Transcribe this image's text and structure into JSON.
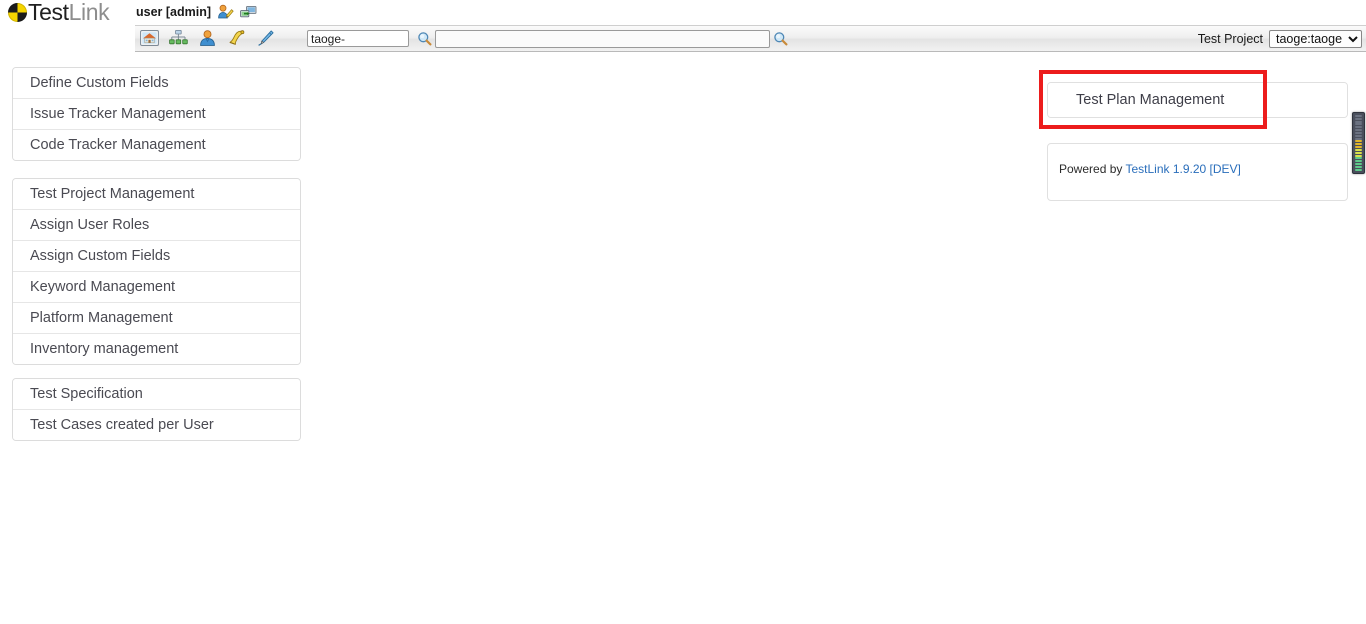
{
  "app": {
    "brand_first": "Test",
    "brand_second": "Link",
    "user_label": "user [admin]"
  },
  "header": {
    "icons": [
      {
        "name": "edit-user-icon",
        "title": "Edit user"
      },
      {
        "name": "logout-icon",
        "title": "Logout"
      }
    ]
  },
  "navbar": {
    "icons": [
      {
        "name": "home-icon",
        "title": "Home"
      },
      {
        "name": "sitemap-icon",
        "title": "Test Project Tree"
      },
      {
        "name": "user-icon",
        "title": "User"
      },
      {
        "name": "bell-icon",
        "title": "Events"
      },
      {
        "name": "pen-icon",
        "title": "Edit"
      }
    ],
    "project_filter_value": "taoge-",
    "project_filter_placeholder": "",
    "search_value": "",
    "search_placeholder": "",
    "search_icon_left": "search-icon",
    "search_icon_right": "search-icon",
    "test_project_label": "Test Project",
    "test_project_selected": "taoge:taoge",
    "test_project_options": [
      "taoge:taoge"
    ]
  },
  "sidebar": {
    "groups": [
      {
        "id": "group-0",
        "items": [
          {
            "label": "Define Custom Fields"
          },
          {
            "label": "Issue Tracker Management"
          },
          {
            "label": "Code Tracker Management"
          }
        ]
      },
      {
        "id": "group-1",
        "items": [
          {
            "label": "Test Project Management"
          },
          {
            "label": "Assign User Roles"
          },
          {
            "label": "Assign Custom Fields"
          },
          {
            "label": "Keyword Management"
          },
          {
            "label": "Platform Management"
          },
          {
            "label": "Inventory management"
          }
        ]
      },
      {
        "id": "group-2",
        "items": [
          {
            "label": "Test Specification"
          },
          {
            "label": "Test Cases created per User"
          }
        ]
      }
    ]
  },
  "right": {
    "plan_item_label": "Test Plan Management",
    "footer_prefix": "Powered by ",
    "footer_link": "TestLink 1.9.20 [DEV]"
  },
  "annotation": {
    "highlight_color": "#ec1c1c",
    "highlight_target": "Test Plan Management"
  },
  "meter": {
    "name": "led-level-meter",
    "segments": [
      "#6a7180",
      "#6a7180",
      "#6a7180",
      "#6a7180",
      "#6a7180",
      "#6a7180",
      "#6a7180",
      "#6a7180",
      "#6a7180",
      "#e0b52a",
      "#e0b52a",
      "#e0b52a",
      "#d8e04a",
      "#d8e04a",
      "#d8e04a",
      "#5ec98a",
      "#5ec98a",
      "#5ec98a",
      "#5ec98a",
      "#5ec98a"
    ]
  }
}
